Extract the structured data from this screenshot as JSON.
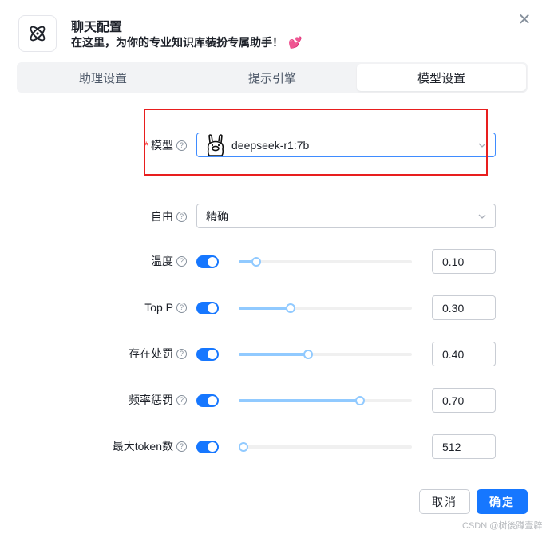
{
  "dialog": {
    "title": "聊天配置",
    "subtitle": "在这里，为你的专业知识库装扮专属助手！",
    "subtitle_emoji": "💕",
    "close_glyph": "✕"
  },
  "tabs": [
    {
      "label": "助理设置",
      "active": false
    },
    {
      "label": "提示引擎",
      "active": false
    },
    {
      "label": "模型设置",
      "active": true
    }
  ],
  "model": {
    "required_mark": "*",
    "label": "模型",
    "value": "deepseek-r1:7b",
    "icon": "llama-icon"
  },
  "freedom": {
    "label": "自由",
    "value": "精确"
  },
  "params": [
    {
      "label": "温度",
      "enabled": true,
      "slider": 0.1,
      "value": "0.10"
    },
    {
      "label": "Top P",
      "enabled": true,
      "slider": 0.3,
      "value": "0.30"
    },
    {
      "label": "存在处罚",
      "enabled": true,
      "slider": 0.4,
      "value": "0.40"
    },
    {
      "label": "频率惩罚",
      "enabled": true,
      "slider": 0.7,
      "value": "0.70"
    },
    {
      "label": "最大token数",
      "enabled": true,
      "slider": 0.0,
      "value": "512"
    }
  ],
  "help_glyph": "?",
  "footer": {
    "cancel": "取消",
    "ok": "确定"
  },
  "watermark": "CSDN @树後蹲壹辟",
  "colors": {
    "primary": "#1677ff",
    "slider_track": "#91caff",
    "highlight": "#e81e1e",
    "required": "#f53f3f"
  }
}
